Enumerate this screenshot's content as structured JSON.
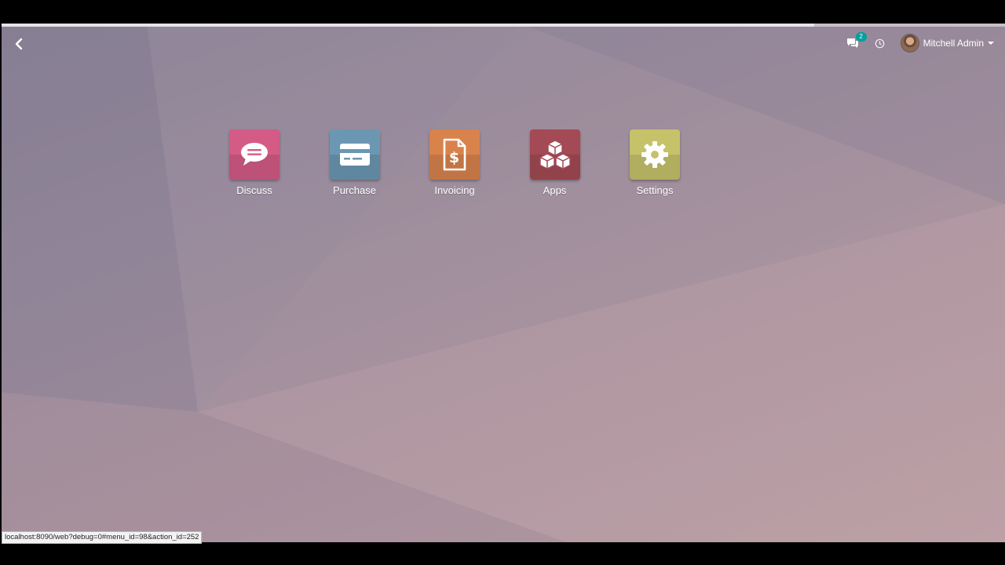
{
  "colors": {
    "discuss": "#d45b85",
    "purchase": "#6b97b3",
    "invoicing": "#d9834c",
    "apps": "#a34a54",
    "settings": "#c6c26a",
    "badge": "#00a09d"
  },
  "navbar": {
    "back_icon": "chevron-left-icon",
    "chat_icon": "chat-icon",
    "chat_badge": "2",
    "activity_icon": "clock-icon",
    "user_name": "Mitchell Admin"
  },
  "apps": [
    {
      "label": "Discuss",
      "icon": "speech-bubble-icon"
    },
    {
      "label": "Purchase",
      "icon": "credit-card-icon"
    },
    {
      "label": "Invoicing",
      "icon": "invoice-dollar-icon"
    },
    {
      "label": "Apps",
      "icon": "cubes-icon"
    },
    {
      "label": "Settings",
      "icon": "gear-icon"
    }
  ],
  "status_bar": {
    "url": "localhost:8090/web?debug=0#menu_id=98&action_id=252"
  }
}
